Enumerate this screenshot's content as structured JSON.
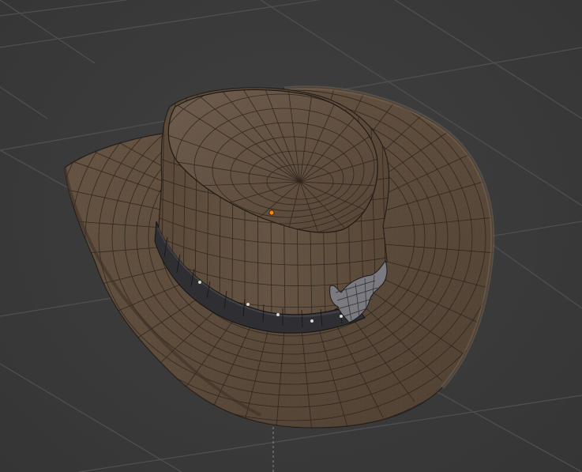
{
  "viewport": {
    "background_color": "#3b3b3b",
    "grid_line_color": "#4f4f4f",
    "object": "cowboy-hat",
    "shading": "textured-with-wireframe",
    "origin_marker_color": "#ff8a00"
  }
}
